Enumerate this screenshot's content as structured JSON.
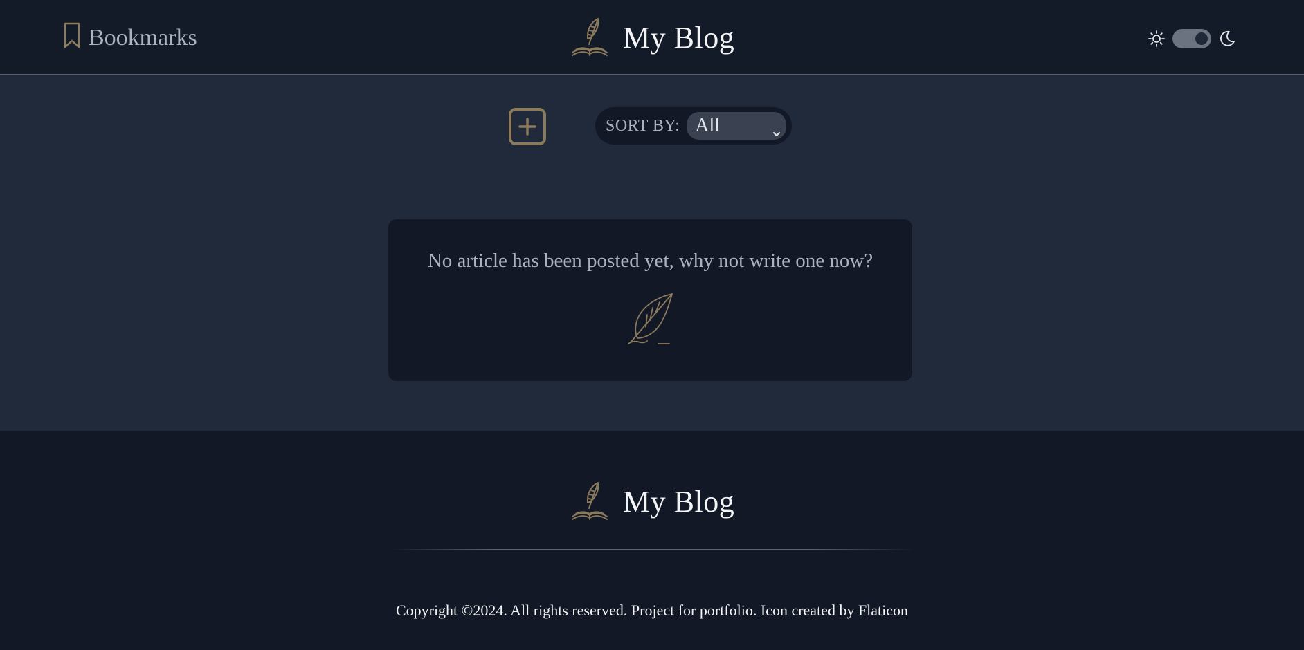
{
  "header": {
    "bookmarks_label": "Bookmarks",
    "brand_title": "My Blog",
    "theme_mode": "dark"
  },
  "toolbar": {
    "sort_label": "SORT BY:",
    "sort_value": "All"
  },
  "main": {
    "empty_message": "No article has been posted yet, why not write one now?"
  },
  "footer": {
    "brand_title": "My Blog",
    "copyright": "Copyright ©2024. All rights reserved. Project for portfolio. Icon created by Flaticon"
  },
  "colors": {
    "header_bg": "#131a28",
    "page_bg": "#212a3a",
    "card_bg": "#121826",
    "accent_gold": "#8b7a5b",
    "muted_text": "#aab2c0"
  },
  "icons": {
    "bookmark": "bookmark-icon",
    "logo": "quill-book-icon",
    "sun": "sun-icon",
    "moon": "moon-icon",
    "add": "plus-square-icon",
    "empty_state": "quill-icon"
  }
}
